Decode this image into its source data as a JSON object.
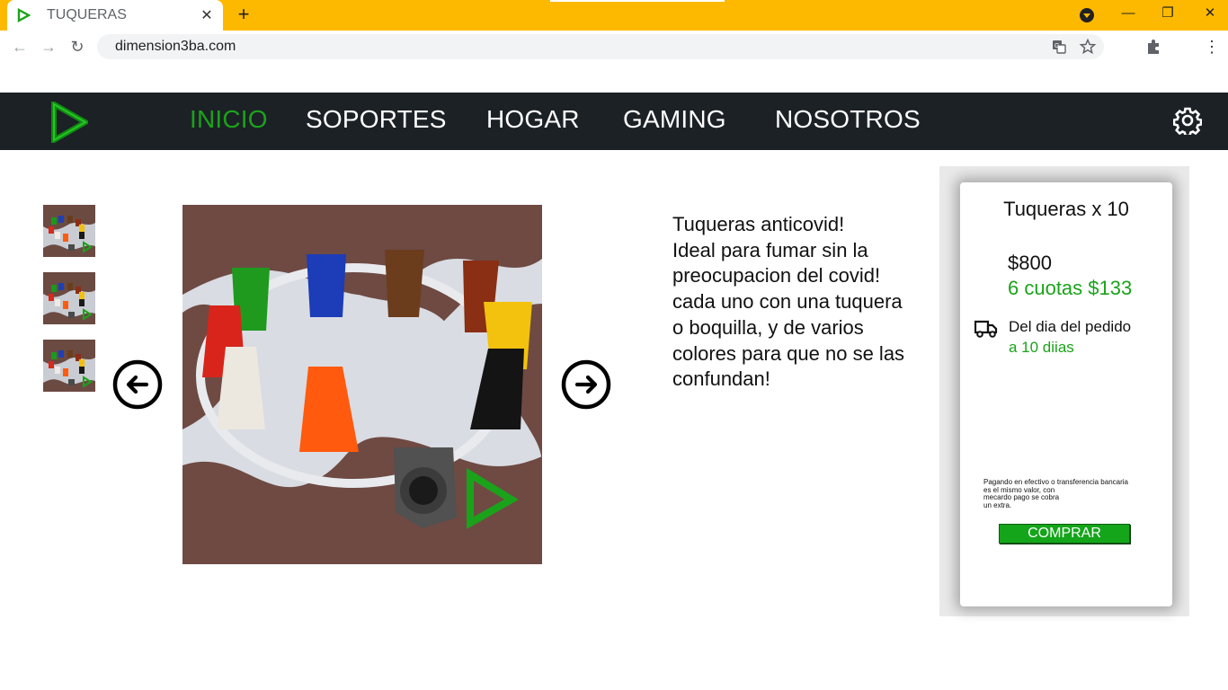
{
  "browser": {
    "tab_title": "TUQUERAS",
    "tab_close": "✕",
    "new_tab": "+",
    "url": "dimension3ba.com",
    "minimize": "—",
    "restore": "❐",
    "close": "✕",
    "menu": "⋮",
    "back": "←",
    "forward": "→",
    "reload": "↻"
  },
  "navbar": {
    "items": [
      "INICIO",
      "SOPORTES",
      "HOGAR",
      "GAMING",
      "NOSOTROS"
    ],
    "active_index": 0
  },
  "product": {
    "description": "Tuqueras anticovid!\nIdeal para fumar sin la\npreocupacion del covid!\ncada uno con una tuquera\no boquilla, y de varios\ncolores para que no se las\nconfundan!"
  },
  "card": {
    "title": "Tuqueras x 10",
    "price": "$800",
    "installments": "6 cuotas $133",
    "shipping_line1": "Del dia del pedido",
    "shipping_line2": "a 10 diias",
    "payment_note": "Pagando en efectivo o transferencia bancaria\nes el mismo valor, con\nmecardo pago se cobra\nun extra.",
    "buy_label": "COMPRAR"
  },
  "colors": {
    "tabbar": "#fdb900",
    "navbar": "#1c2126",
    "accent_green": "#1aa31a",
    "buy_button": "#14a51a"
  },
  "icons": {
    "favicon": "play-triangle-icon",
    "settings": "gear-icon",
    "prev": "arrow-left-circle-icon",
    "next": "arrow-right-circle-icon",
    "shipping": "truck-icon",
    "translate": "translate-icon",
    "bookmark": "star-icon",
    "extensions": "puzzle-icon"
  }
}
